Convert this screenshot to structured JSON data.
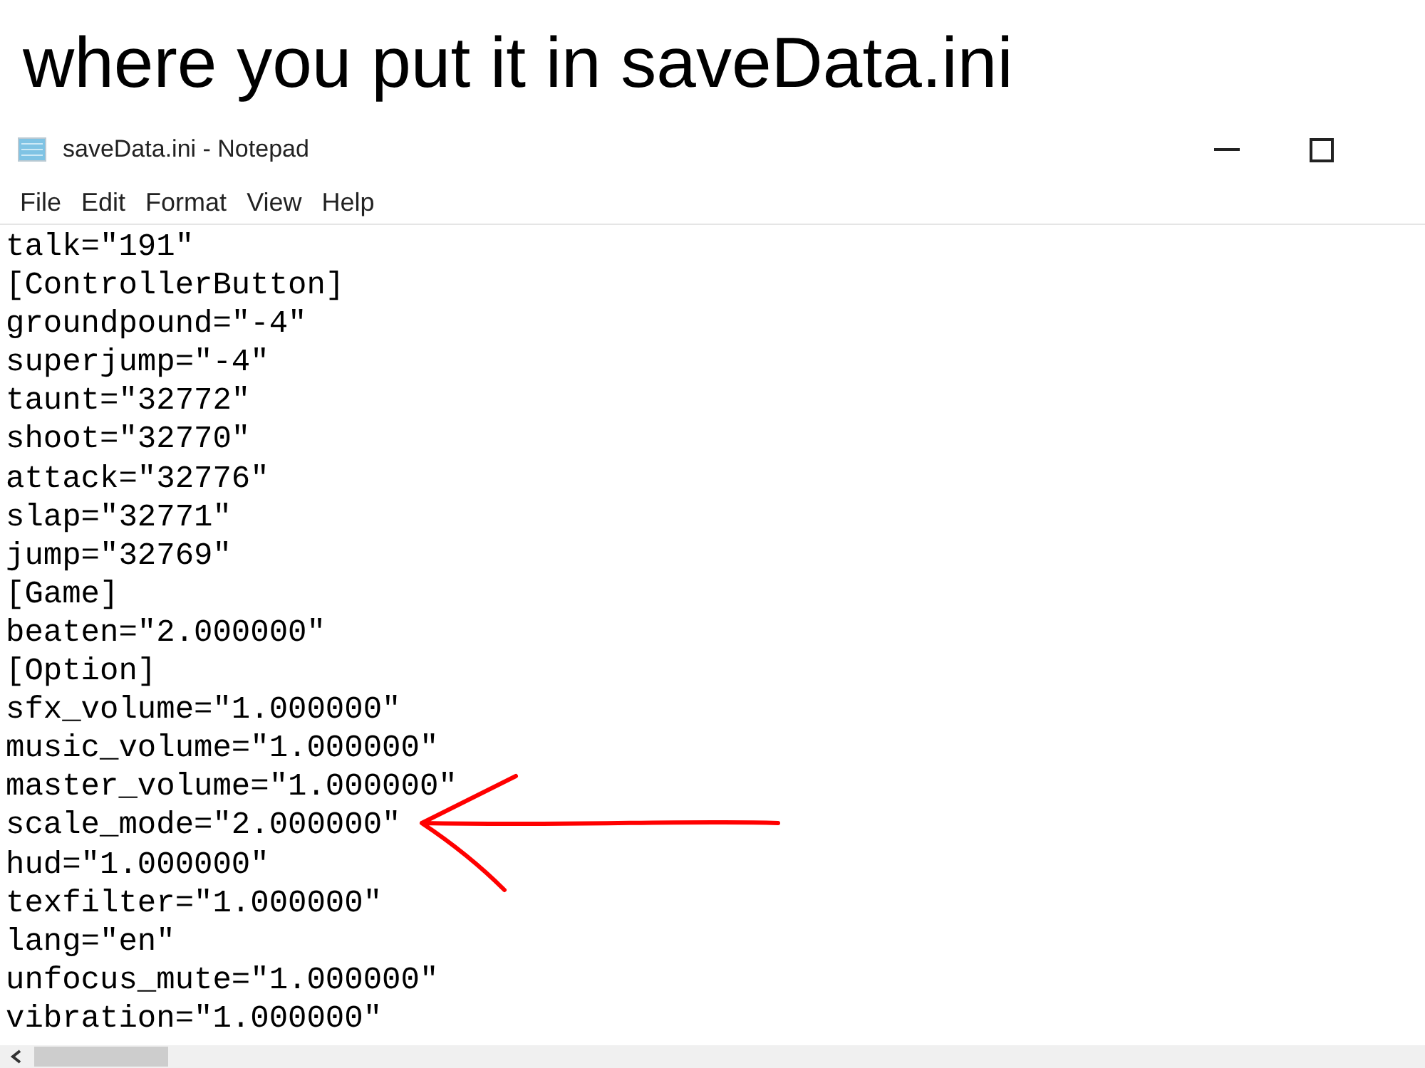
{
  "slide_title": "where you put it in saveData.ini",
  "window": {
    "title": "saveData.ini - Notepad"
  },
  "menu": [
    "File",
    "Edit",
    "Format",
    "View",
    "Help"
  ],
  "lines": [
    "talk=\"191\"",
    "[ControllerButton]",
    "groundpound=\"-4\"",
    "superjump=\"-4\"",
    "taunt=\"32772\"",
    "shoot=\"32770\"",
    "attack=\"32776\"",
    "slap=\"32771\"",
    "jump=\"32769\"",
    "[Game]",
    "beaten=\"2.000000\"",
    "[Option]",
    "sfx_volume=\"1.000000\"",
    "music_volume=\"1.000000\"",
    "master_volume=\"1.000000\"",
    "scale_mode=\"2.000000\"",
    "hud=\"1.000000\"",
    "texfilter=\"1.000000\"",
    "lang=\"en\"",
    "unfocus_mute=\"1.000000\"",
    "vibration=\"1.000000\""
  ]
}
